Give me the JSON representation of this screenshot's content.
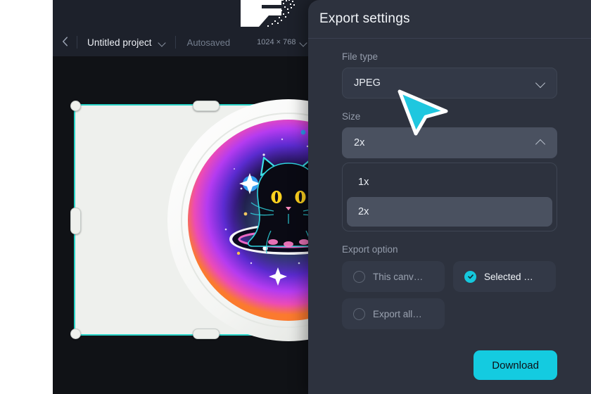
{
  "toolbar": {
    "back_icon": "chevron-left-icon",
    "project_name": "Untitled project",
    "project_caret_icon": "chevron-down-icon",
    "autosaved_label": "Autosaved",
    "canvas_dimensions": "1024 × 768",
    "dimensions_caret_icon": "chevron-down-icon",
    "present_icon": "cursor-play-icon"
  },
  "canvas": {
    "selection_color": "#2ad4c8",
    "artboard_background": "#eef0ed",
    "artwork_name": "cosmic-cat-sticker",
    "handles": [
      "corner-top-left",
      "corner-bottom-left",
      "edge-left",
      "edge-top",
      "edge-bottom"
    ]
  },
  "panel": {
    "title": "Export settings",
    "file_type": {
      "label": "File type",
      "value": "JPEG",
      "caret_icon": "chevron-down-icon"
    },
    "size": {
      "label": "Size",
      "value": "2x",
      "caret_icon": "chevron-up-icon",
      "options": [
        "1x",
        "2x"
      ],
      "selected_option": "2x"
    },
    "export_option": {
      "label": "Export option",
      "choices": [
        {
          "label": "This canv…",
          "selected": false,
          "icon": "radio-empty-icon"
        },
        {
          "label": "Selected …",
          "selected": true,
          "icon": "radio-checked-icon"
        },
        {
          "label": "Export all…",
          "selected": false,
          "icon": "radio-empty-icon"
        }
      ]
    },
    "download_label": "Download"
  },
  "colors": {
    "accent": "#14cbe0",
    "panel_bg": "#2d323e",
    "toolbar_bg": "#1d212b",
    "canvas_bg": "#101216"
  },
  "cursor": {
    "icon": "arrow-cursor-icon",
    "color": "#1fc7df"
  }
}
